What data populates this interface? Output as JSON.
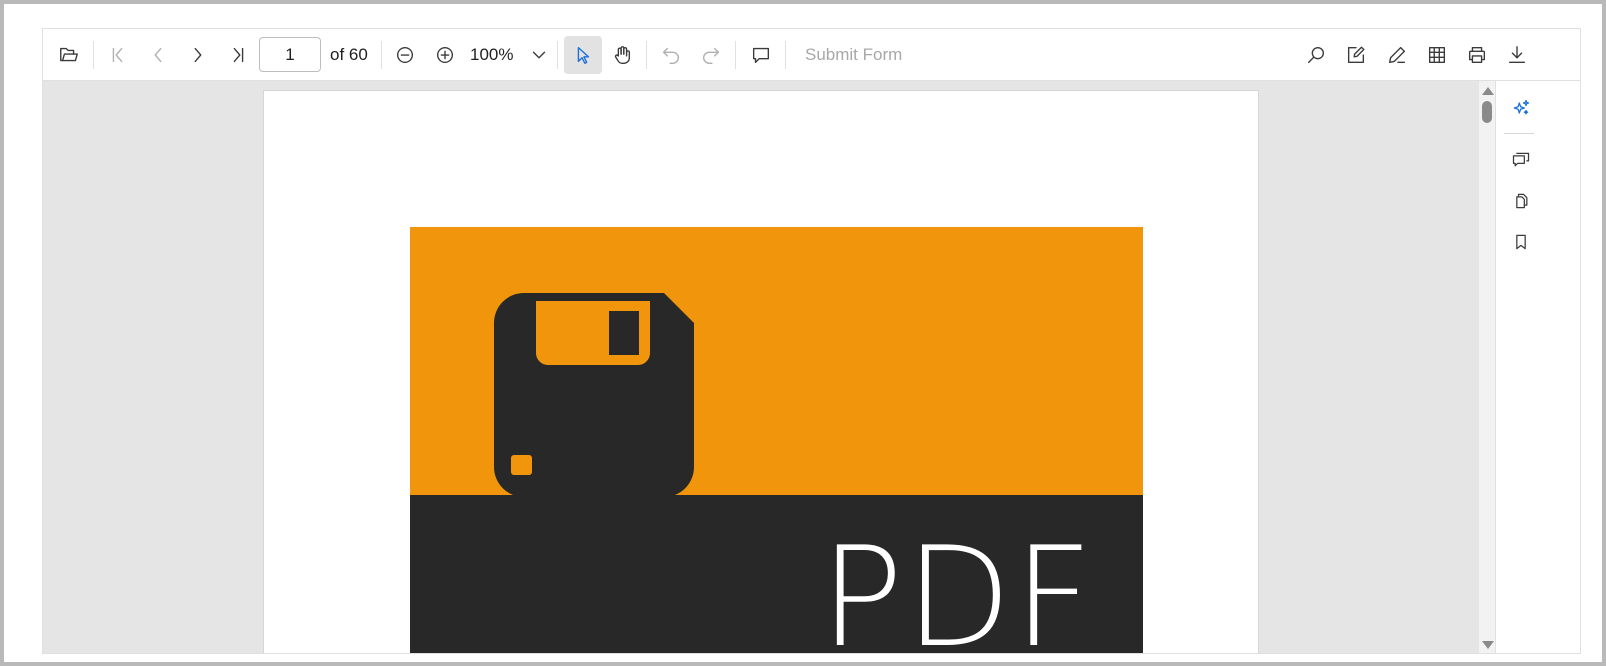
{
  "toolbar": {
    "open_icon": "folder-open-icon",
    "first_page_icon": "first-page-icon",
    "prev_page_icon": "previous-page-icon",
    "next_page_icon": "next-page-icon",
    "last_page_icon": "last-page-icon",
    "current_page": "1",
    "page_count_label": "of 60",
    "zoom_out_icon": "zoom-out-icon",
    "zoom_in_icon": "zoom-in-icon",
    "zoom_value": "100%",
    "zoom_dropdown_icon": "chevron-down-icon",
    "selection_tool_icon": "text-select-cursor-icon",
    "pan_tool_icon": "pan-hand-icon",
    "undo_icon": "undo-icon",
    "redo_icon": "redo-icon",
    "comment_icon": "comment-icon",
    "submit_form_label": "Submit Form",
    "search_icon": "search-icon",
    "edit_annotation_icon": "edit-annotation-icon",
    "draw_icon": "pen-icon",
    "form_designer_icon": "form-designer-icon",
    "print_icon": "print-icon",
    "download_icon": "download-icon"
  },
  "document": {
    "cover_text": "PDF",
    "cover_icon": "floppy-disk-icon",
    "colors": {
      "cover_orange": "#f0950c",
      "cover_dark": "#282828"
    }
  },
  "side_panel": {
    "ai_assist_icon": "sparkle-ai-icon",
    "comments_panel_icon": "comments-panel-icon",
    "thumbnails_icon": "page-thumbnails-icon",
    "bookmarks_icon": "bookmark-icon"
  },
  "colors": {
    "accent": "#1a6fd8",
    "viewer_background": "#e5e5e5",
    "toolbar_background": "#ffffff",
    "disabled_text": "#a8a8a8"
  }
}
